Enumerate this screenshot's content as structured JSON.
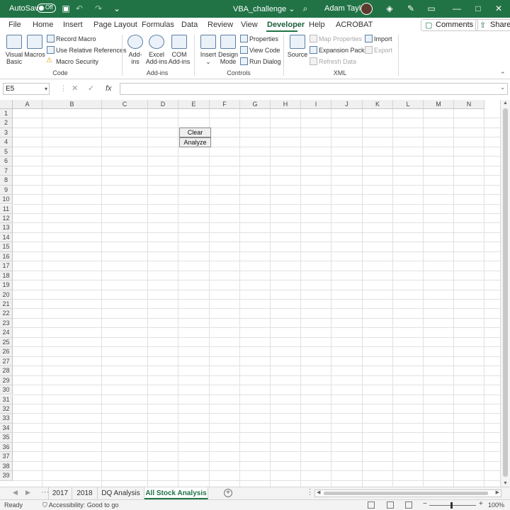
{
  "titlebar": {
    "autosave_label": "AutoSave",
    "autosave_state": "Off",
    "doc_title": "VBA_challenge",
    "doc_title_caret": "⌄",
    "user_name": "Adam Taylor"
  },
  "tabs": [
    "File",
    "Home",
    "Insert",
    "Page Layout",
    "Formulas",
    "Data",
    "Review",
    "View",
    "Developer",
    "Help",
    "ACROBAT"
  ],
  "active_tab": "Developer",
  "comments_label": "Comments",
  "share_label": "Share",
  "ribbon": {
    "code": {
      "visual_basic": [
        "Visual",
        "Basic"
      ],
      "macros": "Macros",
      "record_macro": "Record Macro",
      "relative_refs": "Use Relative References",
      "macro_security": "Macro Security",
      "group_label": "Code"
    },
    "addins": {
      "addins": [
        "Add-",
        "ins"
      ],
      "excel_addins": [
        "Excel",
        "Add-ins"
      ],
      "com_addins": [
        "COM",
        "Add-ins"
      ],
      "group_label": "Add-ins"
    },
    "controls": {
      "insert": "Insert",
      "insert_caret": "⌄",
      "design_mode": [
        "Design",
        "Mode"
      ],
      "properties": "Properties",
      "view_code": "View Code",
      "run_dialog": "Run Dialog",
      "group_label": "Controls"
    },
    "xml": {
      "source": "Source",
      "map_properties": "Map Properties",
      "expansion_packs": "Expansion Packs",
      "refresh_data": "Refresh Data",
      "import": "Import",
      "export": "Export",
      "group_label": "XML"
    }
  },
  "formula_bar": {
    "name_box": "E5",
    "cancel": "✕",
    "enter": "✓",
    "fx": "fx",
    "formula": ""
  },
  "grid": {
    "columns": [
      "A",
      "B",
      "C",
      "D",
      "E",
      "F",
      "G",
      "H",
      "I",
      "J",
      "K",
      "L",
      "M",
      "N"
    ],
    "rows": [
      "1",
      "2",
      "3",
      "4",
      "5",
      "6",
      "7",
      "8",
      "9",
      "10",
      "11",
      "12",
      "13",
      "14",
      "15",
      "16",
      "17",
      "18",
      "19",
      "20",
      "21",
      "22",
      "23",
      "24",
      "25",
      "26",
      "27",
      "28",
      "29",
      "30",
      "31",
      "32",
      "33",
      "34",
      "35",
      "36",
      "37",
      "38",
      "39"
    ],
    "buttons": {
      "clear": "Clear",
      "analyze": "Analyze"
    }
  },
  "sheet_tabs": [
    "2017",
    "2018",
    "DQ Analysis",
    "All Stock Analysis"
  ],
  "active_sheet": "All Stock Analysis",
  "status": {
    "ready": "Ready",
    "accessibility": "Accessibility: Good to go",
    "zoom": "100%"
  },
  "colors": {
    "excel_green": "#217346",
    "header_gray": "#f0f0f0",
    "gridline": "#e1e1e1"
  }
}
